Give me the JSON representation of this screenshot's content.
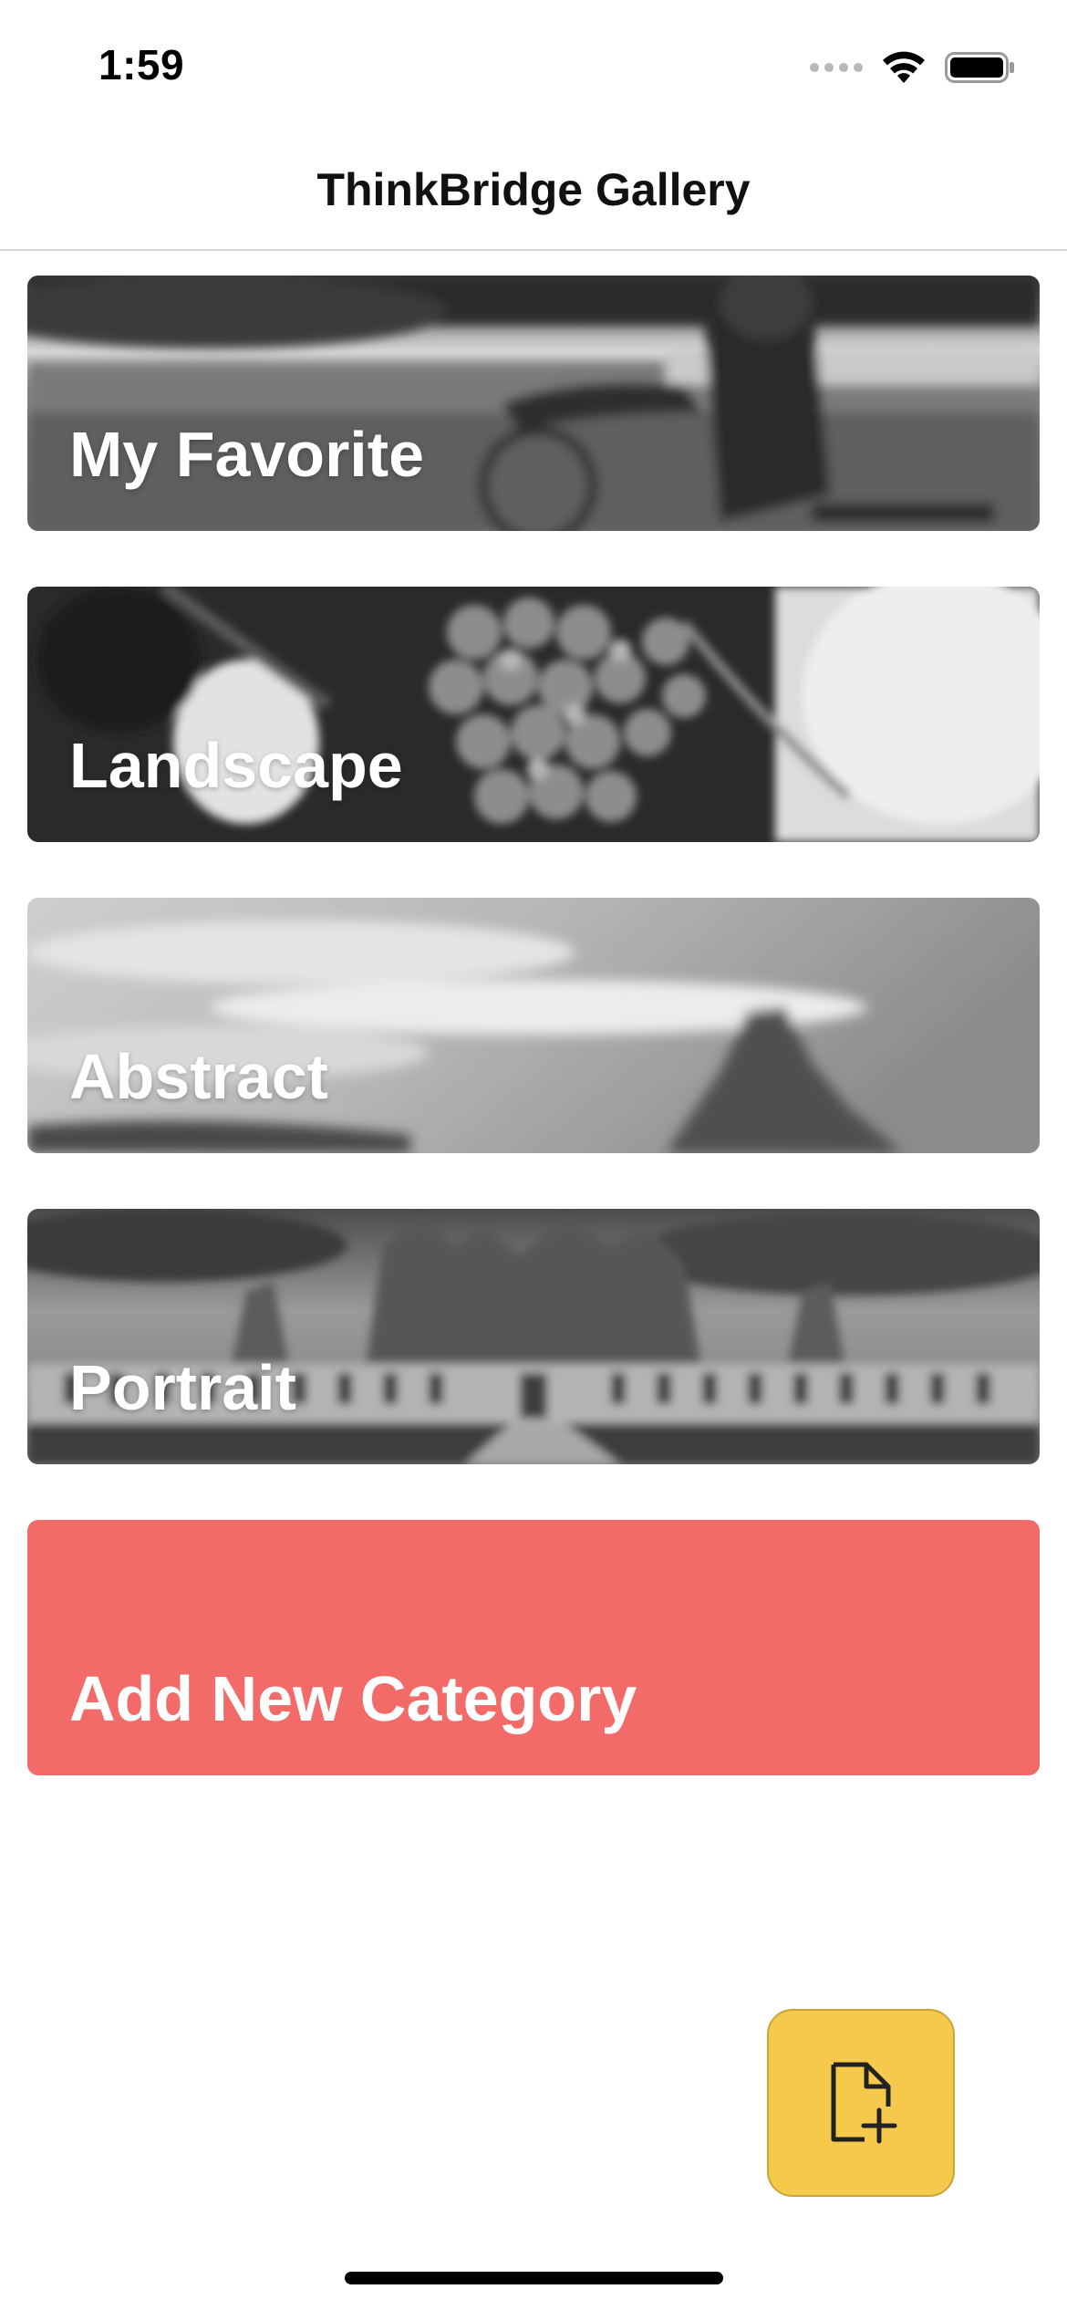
{
  "status_bar": {
    "time": "1:59"
  },
  "nav": {
    "title": "ThinkBridge Gallery"
  },
  "categories": [
    {
      "label": "My Favorite",
      "image": "cyclist-photo"
    },
    {
      "label": "Landscape",
      "image": "grapes-photo"
    },
    {
      "label": "Abstract",
      "image": "mountain-sky-photo"
    },
    {
      "label": "Portrait",
      "image": "castle-photo"
    }
  ],
  "add_category": {
    "label": "Add New Category",
    "color": "#f26b69"
  },
  "fab": {
    "icon": "file-plus-icon",
    "color": "#f5c94b"
  }
}
